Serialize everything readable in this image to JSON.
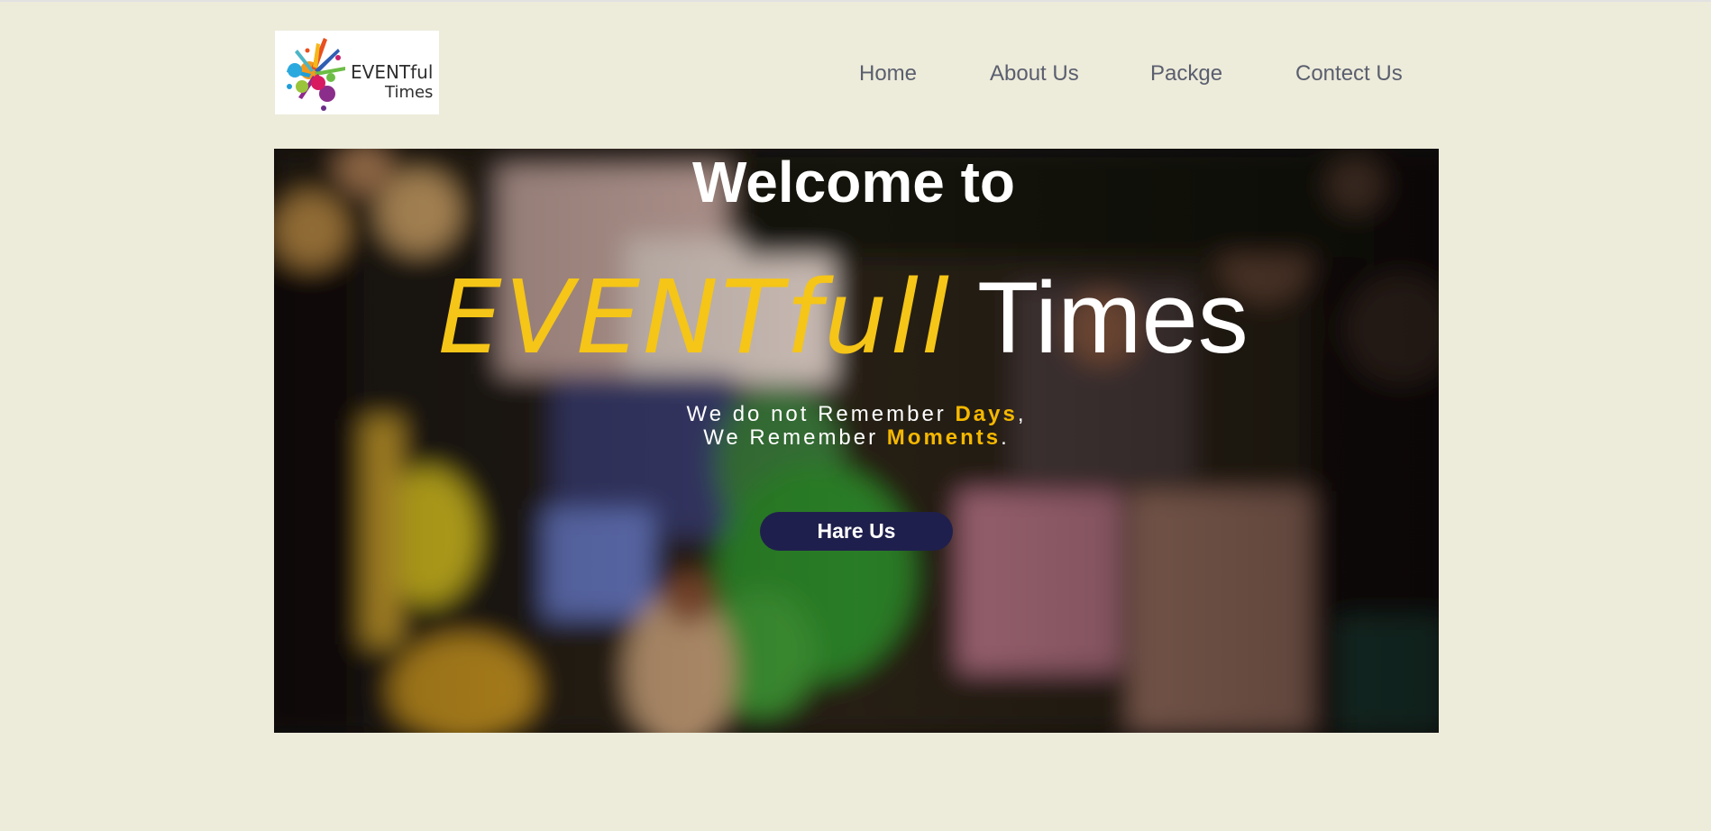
{
  "logo": {
    "line1": "EVENTful",
    "line2": "Times"
  },
  "nav": {
    "items": [
      "Home",
      "About Us",
      "Packge",
      "Contect Us"
    ]
  },
  "hero": {
    "welcome": "Welcome to",
    "brand_part1": "EVENTfull",
    "brand_part2": "Times",
    "tagline": {
      "line1_pre": "We do not Remember ",
      "line1_hl": "Days",
      "line1_post": ",",
      "line2_pre": "We Remember ",
      "line2_hl": "Moments",
      "line2_post": "."
    },
    "cta_label": "Hare Us"
  },
  "colors": {
    "page_bg": "#edebda",
    "accent_yellow": "#f5c518",
    "button_navy": "#1f1f4d",
    "nav_text": "#5a5f6e"
  },
  "icons": [
    "logo-splash-icon"
  ]
}
